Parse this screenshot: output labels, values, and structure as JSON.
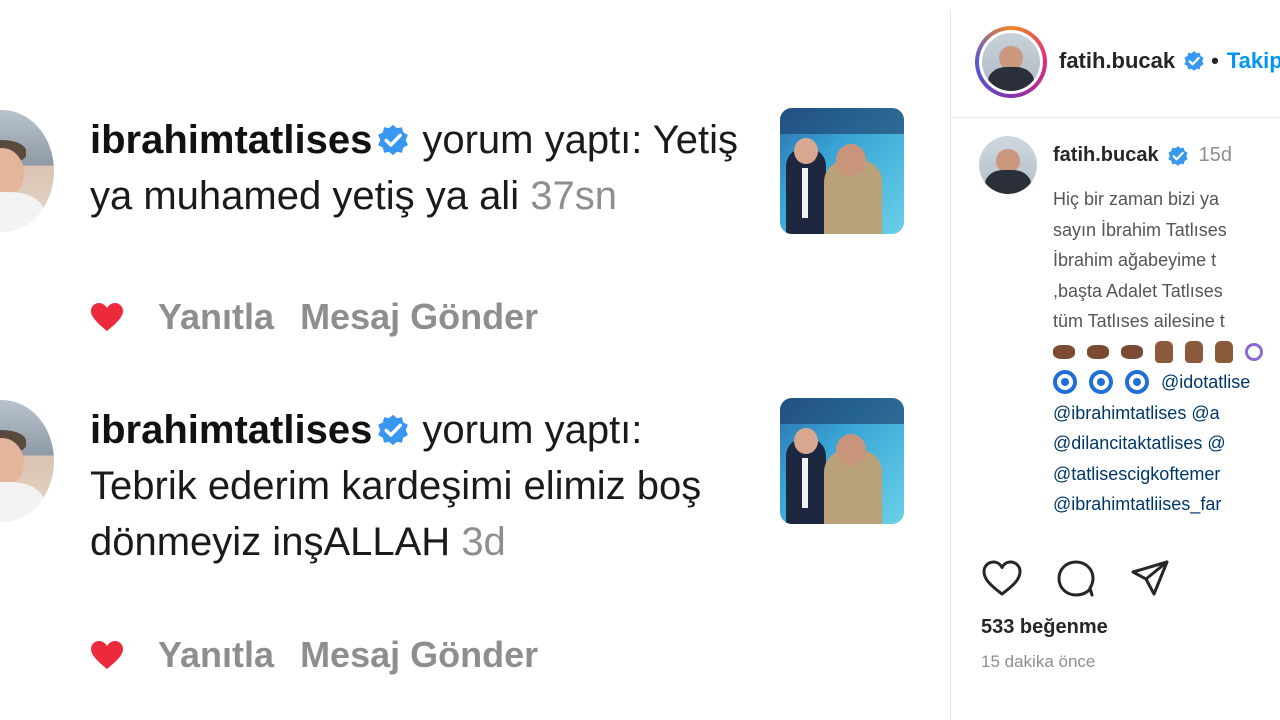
{
  "notifications": [
    {
      "username": "ibrahimtatlises",
      "action": "yorum yaptı:",
      "comment": "Yetiş ya muhamed yetiş ya ali",
      "time": "37sn",
      "reply_label": "Yanıtla",
      "message_label": "Mesaj Gönder"
    },
    {
      "username": "ibrahimtatlises",
      "action": "yorum yaptı:",
      "comment": "Tebrik ederim kardeşimi elimiz boş dönmeyiz inşALLAH",
      "time": "3d",
      "reply_label": "Yanıtla",
      "message_label": "Mesaj Gönder"
    }
  ],
  "post": {
    "header": {
      "username": "fatih.bucak",
      "separator": "•",
      "follow_label": "Takip"
    },
    "caption": {
      "username": "fatih.bucak",
      "time": "15d",
      "lines": [
        "Hiç bir zaman bizi ya",
        "sayın İbrahim Tatlıses",
        "İbrahim ağabeyime t",
        ",başta Adalet Tatlıses",
        "tüm Tatlıses ailesine t"
      ],
      "mentions": [
        "@idotatlise",
        "@ibrahimtatlises @a",
        "@dilancitaktatlises @",
        "@tatlisescigkoftemer",
        "@ibrahimtatliises_far"
      ]
    },
    "likes": "533 beğenme",
    "time_ago": "15 dakika önce"
  },
  "colors": {
    "verified": "#3897f0",
    "heart": "#ed2a3c",
    "muted": "#8e8e8e",
    "follow": "#0095f6",
    "mention": "#00376b"
  },
  "icons": {
    "like": "heart-icon",
    "comment": "comment-icon",
    "share": "send-icon",
    "verified": "verified-badge-icon"
  }
}
